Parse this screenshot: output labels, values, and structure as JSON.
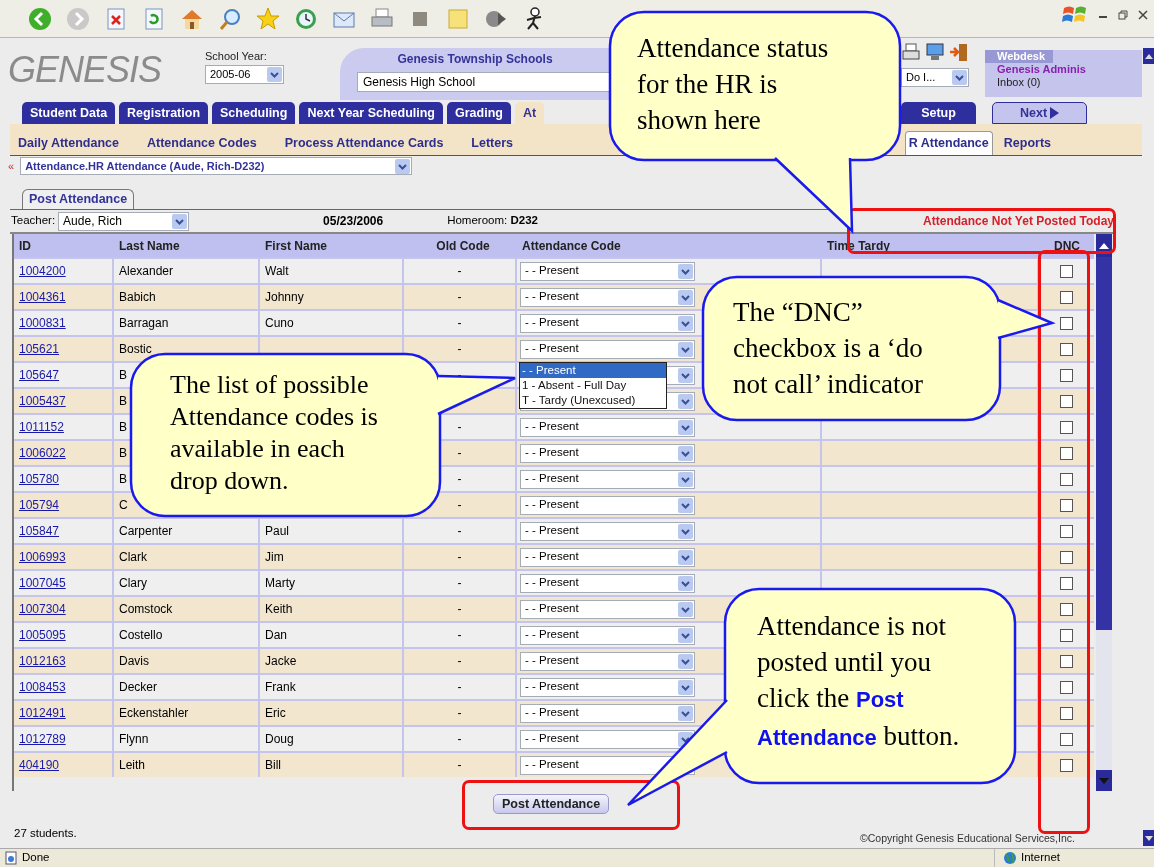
{
  "header": {
    "logo": "GENESIS",
    "school_year_label": "School Year:",
    "school_year": "2005-06",
    "district": "Genesis Township Schools",
    "school": "Genesis High School",
    "quick_select": "Do I...",
    "webdesk": {
      "title": "Webdesk",
      "user": "Genesis Adminis",
      "inbox": "Inbox (0)"
    }
  },
  "main_tabs": [
    {
      "label": "Student Data",
      "selected": false
    },
    {
      "label": "Registration",
      "selected": false
    },
    {
      "label": "Scheduling",
      "selected": false
    },
    {
      "label": "Next Year Scheduling",
      "selected": false
    },
    {
      "label": "Grading",
      "selected": false
    },
    {
      "label": "At",
      "selected": true
    },
    {
      "label": "Setup",
      "selected": false
    }
  ],
  "next_button": "Next",
  "sub_tabs": [
    {
      "label": "Daily Attendance",
      "selected": false
    },
    {
      "label": "Attendance Codes",
      "selected": false
    },
    {
      "label": "Process Attendance Cards",
      "selected": false
    },
    {
      "label": "Letters",
      "selected": false
    },
    {
      "label": "R Attendance",
      "selected": true
    },
    {
      "label": "Reports",
      "selected": false
    }
  ],
  "breadcrumb": {
    "marker": "«",
    "value": "Attendance.HR Attendance (Aude, Rich-D232)"
  },
  "panel_tab": "Post Attendance",
  "info_bar": {
    "teacher_label": "Teacher:",
    "teacher": "Aude, Rich",
    "date": "05/23/2006",
    "homeroom": "Homeroom: **D232**",
    "status": "Attendance Not Yet Posted Today"
  },
  "table": {
    "columns": [
      "ID",
      "Last Name",
      "First Name",
      "Old Code",
      "Attendance Code",
      "Time Tardy",
      "DNC"
    ],
    "rows": [
      {
        "id": "1004200",
        "last_name": "Alexander",
        "first_name": "Walt",
        "old_code": "-",
        "code": "- - Present",
        "dnc": false
      },
      {
        "id": "1004361",
        "last_name": "Babich",
        "first_name": "Johnny",
        "old_code": "-",
        "code": "- - Present",
        "dnc": false
      },
      {
        "id": "1000831",
        "last_name": "Barragan",
        "first_name": "Cuno",
        "old_code": "-",
        "code": "- - Present",
        "dnc": false
      },
      {
        "id": "105621",
        "last_name": "Bostic",
        "old_code": "-",
        "code": "- - Present",
        "dnc": false
      },
      {
        "id": "105647",
        "last_name": "B",
        "old_code": "-",
        "dnc": false
      },
      {
        "id": "1005437",
        "last_name": "B",
        "dnc": false
      },
      {
        "id": "1011152",
        "last_name": "B",
        "old_code": "-",
        "code": "- - Present",
        "dnc": false
      },
      {
        "id": "1006022",
        "last_name": "B",
        "old_code": "-",
        "code": "- - Present",
        "dnc": false
      },
      {
        "id": "105780",
        "last_name": "B",
        "old_code": "-",
        "code": "- - Present",
        "dnc": false
      },
      {
        "id": "105794",
        "last_name": "C",
        "old_code": "-",
        "code": "- - Present",
        "dnc": false
      },
      {
        "id": "105847",
        "last_name": "Carpenter",
        "first_name": "Paul",
        "old_code": "-",
        "code": "- - Present",
        "dnc": false
      },
      {
        "id": "1006993",
        "last_name": "Clark",
        "first_name": "Jim",
        "old_code": "-",
        "code": "- - Present",
        "dnc": false
      },
      {
        "id": "1007045",
        "last_name": "Clary",
        "first_name": "Marty",
        "old_code": "-",
        "code": "- - Present",
        "dnc": false
      },
      {
        "id": "1007304",
        "last_name": "Comstock",
        "first_name": "Keith",
        "old_code": "-",
        "code": "- - Present",
        "dnc": false
      },
      {
        "id": "1005095",
        "last_name": "Costello",
        "first_name": "Dan",
        "old_code": "-",
        "code": "- - Present",
        "dnc": false
      },
      {
        "id": "1012163",
        "last_name": "Davis",
        "first_name": "Jacke",
        "old_code": "-",
        "code": "- - Present",
        "dnc": false
      },
      {
        "id": "1008453",
        "last_name": "Decker",
        "first_name": "Frank",
        "old_code": "-",
        "code": "- - Present",
        "dnc": false
      },
      {
        "id": "1012491",
        "last_name": "Eckenstahler",
        "first_name": "Eric",
        "old_code": "-",
        "code": "- - Present",
        "dnc": false
      },
      {
        "id": "1012789",
        "last_name": "Flynn",
        "first_name": "Doug",
        "old_code": "-",
        "code": "- - Present",
        "dnc": false
      },
      {
        "id": "404190",
        "last_name": "Leith",
        "first_name": "Bill",
        "old_code": "-",
        "code": "- - Present",
        "dnc": false
      }
    ]
  },
  "open_dropdown": {
    "options": [
      {
        "label": "- - Present",
        "selected": true
      },
      {
        "label": "1 - Absent - Full Day",
        "selected": false
      },
      {
        "label": "T - Tardy (Unexcused)",
        "selected": false
      }
    ]
  },
  "post_button": "Post Attendance",
  "student_count": "27 students.",
  "copyright": "©Copyright Genesis Educational Services,Inc.",
  "status_bar": {
    "left": "Done",
    "zone": "Internet"
  },
  "callouts": [
    {
      "text": "Attendance status for the HR is shown here"
    },
    {
      "text": "The list of possible Attendance codes is available in each drop down."
    },
    {
      "text": "The “DNC” checkbox is a ‘do not call’ indicator"
    },
    {
      "text": "Attendance is not posted until you click the **Post Attendance** button."
    }
  ]
}
